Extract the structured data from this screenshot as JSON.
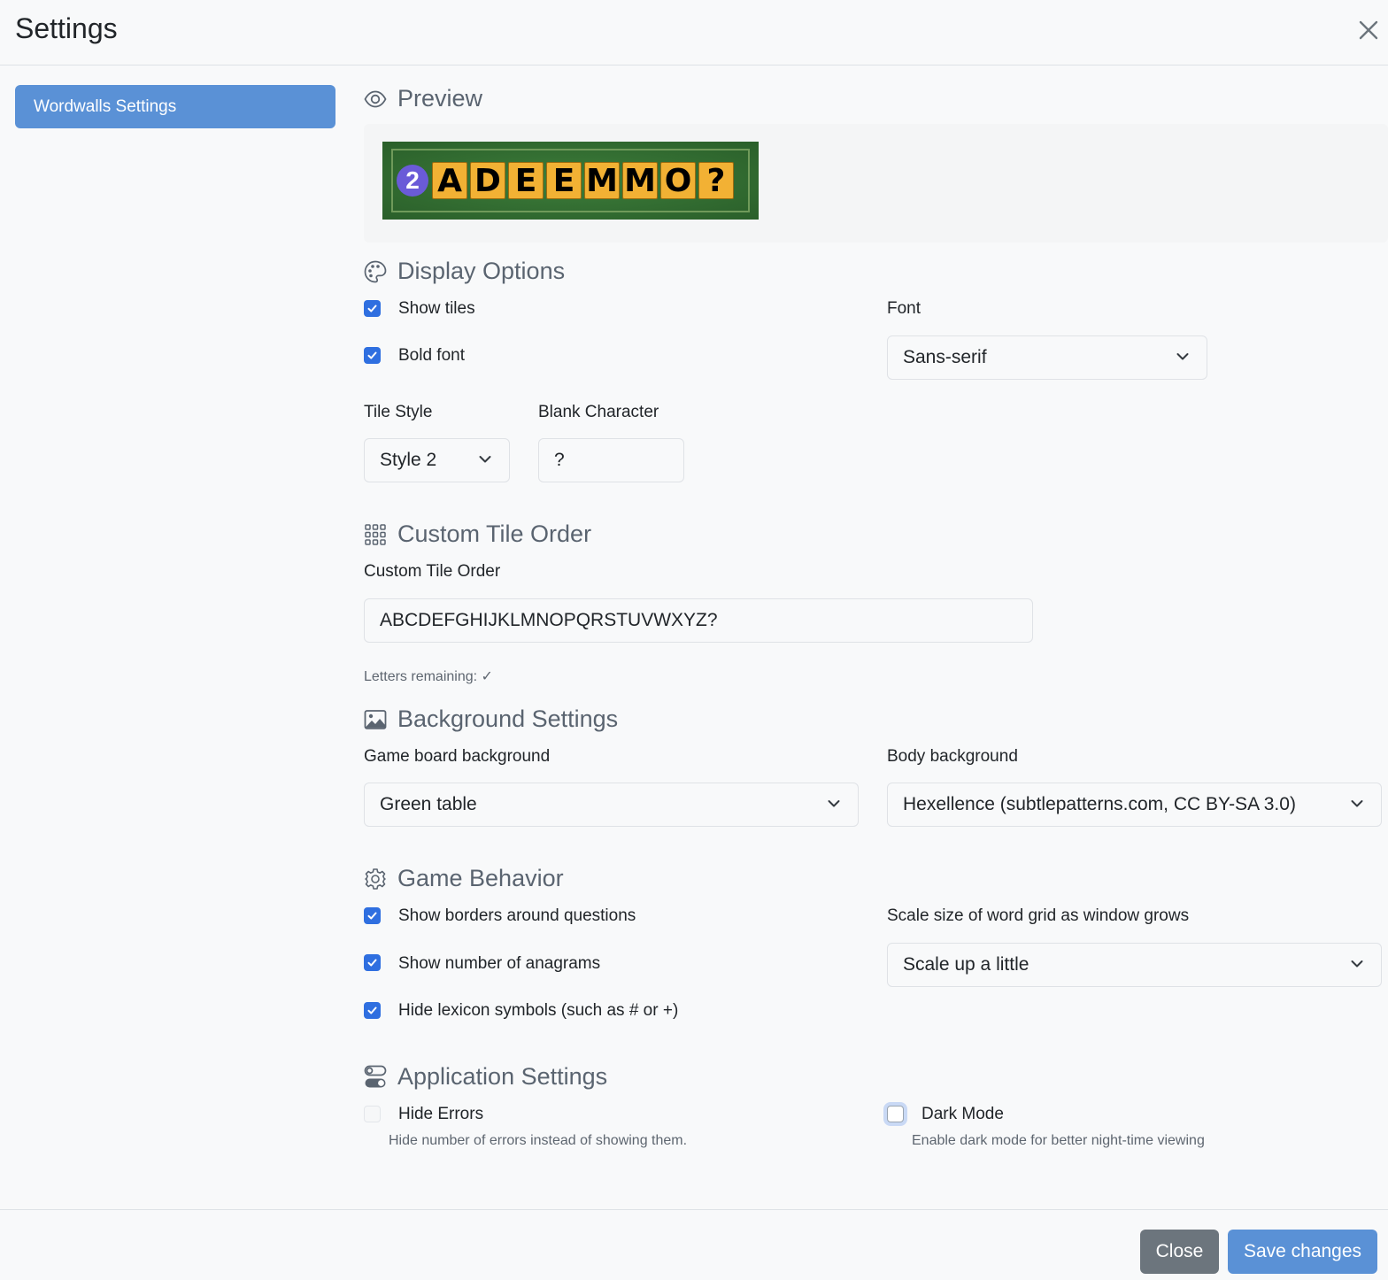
{
  "header": {
    "title": "Settings"
  },
  "sidebar": {
    "items": [
      {
        "label": "Wordwalls Settings",
        "active": true
      }
    ]
  },
  "preview": {
    "title": "Preview",
    "badge": "2",
    "tiles": [
      "A",
      "D",
      "E",
      "E",
      "M",
      "M",
      "O",
      "?"
    ]
  },
  "display": {
    "title": "Display Options",
    "show_tiles": {
      "label": "Show tiles",
      "checked": true
    },
    "bold_font": {
      "label": "Bold font",
      "checked": true
    },
    "font_label": "Font",
    "font_value": "Sans-serif",
    "tile_style_label": "Tile Style",
    "tile_style_value": "Style 2",
    "blank_char_label": "Blank Character",
    "blank_char_value": "?"
  },
  "custom_order": {
    "title": "Custom Tile Order",
    "label": "Custom Tile Order",
    "value": "ABCDEFGHIJKLMNOPQRSTUVWXYZ?",
    "remaining": "Letters remaining: ✓"
  },
  "background": {
    "title": "Background Settings",
    "board_label": "Game board background",
    "board_value": "Green table",
    "body_label": "Body background",
    "body_value": "Hexellence (subtlepatterns.com, CC BY-SA 3.0)"
  },
  "behavior": {
    "title": "Game Behavior",
    "borders": {
      "label": "Show borders around questions",
      "checked": true
    },
    "anagrams": {
      "label": "Show number of anagrams",
      "checked": true
    },
    "lexicon": {
      "label": "Hide lexicon symbols (such as # or +)",
      "checked": true
    },
    "scale_label": "Scale size of word grid as window grows",
    "scale_value": "Scale up a little"
  },
  "app": {
    "title": "Application Settings",
    "hide_errors": {
      "label": "Hide Errors",
      "checked": false,
      "help": "Hide number of errors instead of showing them."
    },
    "dark_mode": {
      "label": "Dark Mode",
      "checked": false,
      "help": "Enable dark mode for better night-time viewing"
    }
  },
  "footer": {
    "close_label": "Close",
    "save_label": "Save changes"
  },
  "colors": {
    "primary": "#5a91d6",
    "checkbox": "#2f6fe0",
    "secondary": "#6c757d",
    "tile": "#f2b134",
    "board": "#2e6b2e"
  }
}
